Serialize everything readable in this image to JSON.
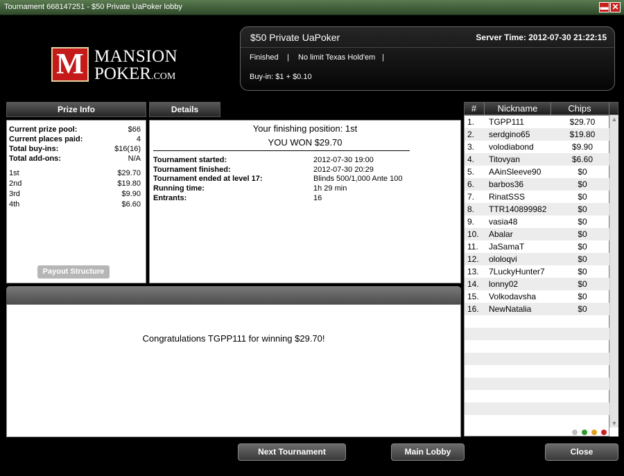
{
  "window": {
    "title": "Tournament 668147251 - $50 Private UaPoker lobby",
    "minimize": "▬",
    "close": "✕"
  },
  "logo": {
    "mark": "M",
    "line1": "MANSION",
    "line2": "POKER",
    "line2_suffix": ".COM"
  },
  "info": {
    "tournament_name": "$50 Private UaPoker",
    "server_time": "Server Time: 2012-07-30 21:22:15",
    "status": "Finished",
    "separator": "|",
    "game": "No limit Texas Hold'em",
    "buyin": "Buy-in: $1 + $0.10"
  },
  "prize_info": {
    "tab": "Prize Info",
    "rows": [
      {
        "label": "Current prize pool:",
        "value": "$66"
      },
      {
        "label": "Current places paid:",
        "value": "4"
      },
      {
        "label": "Total buy-ins:",
        "value": "$16(16)"
      },
      {
        "label": "Total add-ons:",
        "value": "N/A"
      }
    ],
    "places": [
      {
        "place": "1st",
        "amount": "$29.70"
      },
      {
        "place": "2nd",
        "amount": "$19.80"
      },
      {
        "place": "3rd",
        "amount": "$9.90"
      },
      {
        "place": "4th",
        "amount": "$6.60"
      }
    ],
    "payout_button": "Payout Structure"
  },
  "details": {
    "tab": "Details",
    "finishing_position": "Your finishing position: 1st",
    "won": "YOU WON $29.70",
    "rows": [
      {
        "label": "Tournament started:",
        "value": "2012-07-30 19:00"
      },
      {
        "label": "Tournament finished:",
        "value": "2012-07-30 20:29"
      },
      {
        "label": "Tournament ended at level 17:",
        "value": "Blinds 500/1,000 Ante 100"
      },
      {
        "label": "Running time:",
        "value": "1h 29 min"
      },
      {
        "label": "Entrants:",
        "value": "16"
      }
    ]
  },
  "congrats": "Congratulations TGPP111 for winning $29.70!",
  "players": {
    "headers": {
      "num": "#",
      "nick": "Nickname",
      "chips": "Chips"
    },
    "rows": [
      {
        "n": "1.",
        "nick": "TGPP111",
        "chips": "$29.70"
      },
      {
        "n": "2.",
        "nick": "serdgino65",
        "chips": "$19.80"
      },
      {
        "n": "3.",
        "nick": "volodiabond",
        "chips": "$9.90"
      },
      {
        "n": "4.",
        "nick": "Titovyan",
        "chips": "$6.60"
      },
      {
        "n": "5.",
        "nick": "AAinSleeve90",
        "chips": "$0"
      },
      {
        "n": "6.",
        "nick": "barbos36",
        "chips": "$0"
      },
      {
        "n": "7.",
        "nick": "RinatSSS",
        "chips": "$0"
      },
      {
        "n": "8.",
        "nick": "TTR140899982",
        "chips": "$0"
      },
      {
        "n": "9.",
        "nick": "vasia48",
        "chips": "$0"
      },
      {
        "n": "10.",
        "nick": "Abalar",
        "chips": "$0"
      },
      {
        "n": "11.",
        "nick": "JaSamaT",
        "chips": "$0"
      },
      {
        "n": "12.",
        "nick": "ololoqvi",
        "chips": "$0"
      },
      {
        "n": "13.",
        "nick": "7LuckyHunter7",
        "chips": "$0"
      },
      {
        "n": "14.",
        "nick": "lonny02",
        "chips": "$0"
      },
      {
        "n": "15.",
        "nick": "Volkodavsha",
        "chips": "$0"
      },
      {
        "n": "16.",
        "nick": "NewNatalia",
        "chips": "$0"
      },
      {
        "n": "",
        "nick": "",
        "chips": ""
      },
      {
        "n": "",
        "nick": "",
        "chips": ""
      },
      {
        "n": "",
        "nick": "",
        "chips": ""
      },
      {
        "n": "",
        "nick": "",
        "chips": ""
      },
      {
        "n": "",
        "nick": "",
        "chips": ""
      },
      {
        "n": "",
        "nick": "",
        "chips": ""
      },
      {
        "n": "",
        "nick": "",
        "chips": ""
      },
      {
        "n": "",
        "nick": "",
        "chips": ""
      },
      {
        "n": "",
        "nick": "",
        "chips": ""
      }
    ],
    "scroll_up": "▲",
    "scroll_down": "▼",
    "status_dots": [
      "#c0c0c0",
      "#2e9a2e",
      "#e0a020",
      "#d02020"
    ]
  },
  "buttons": {
    "next": "Next Tournament",
    "main": "Main Lobby",
    "close": "Close"
  }
}
